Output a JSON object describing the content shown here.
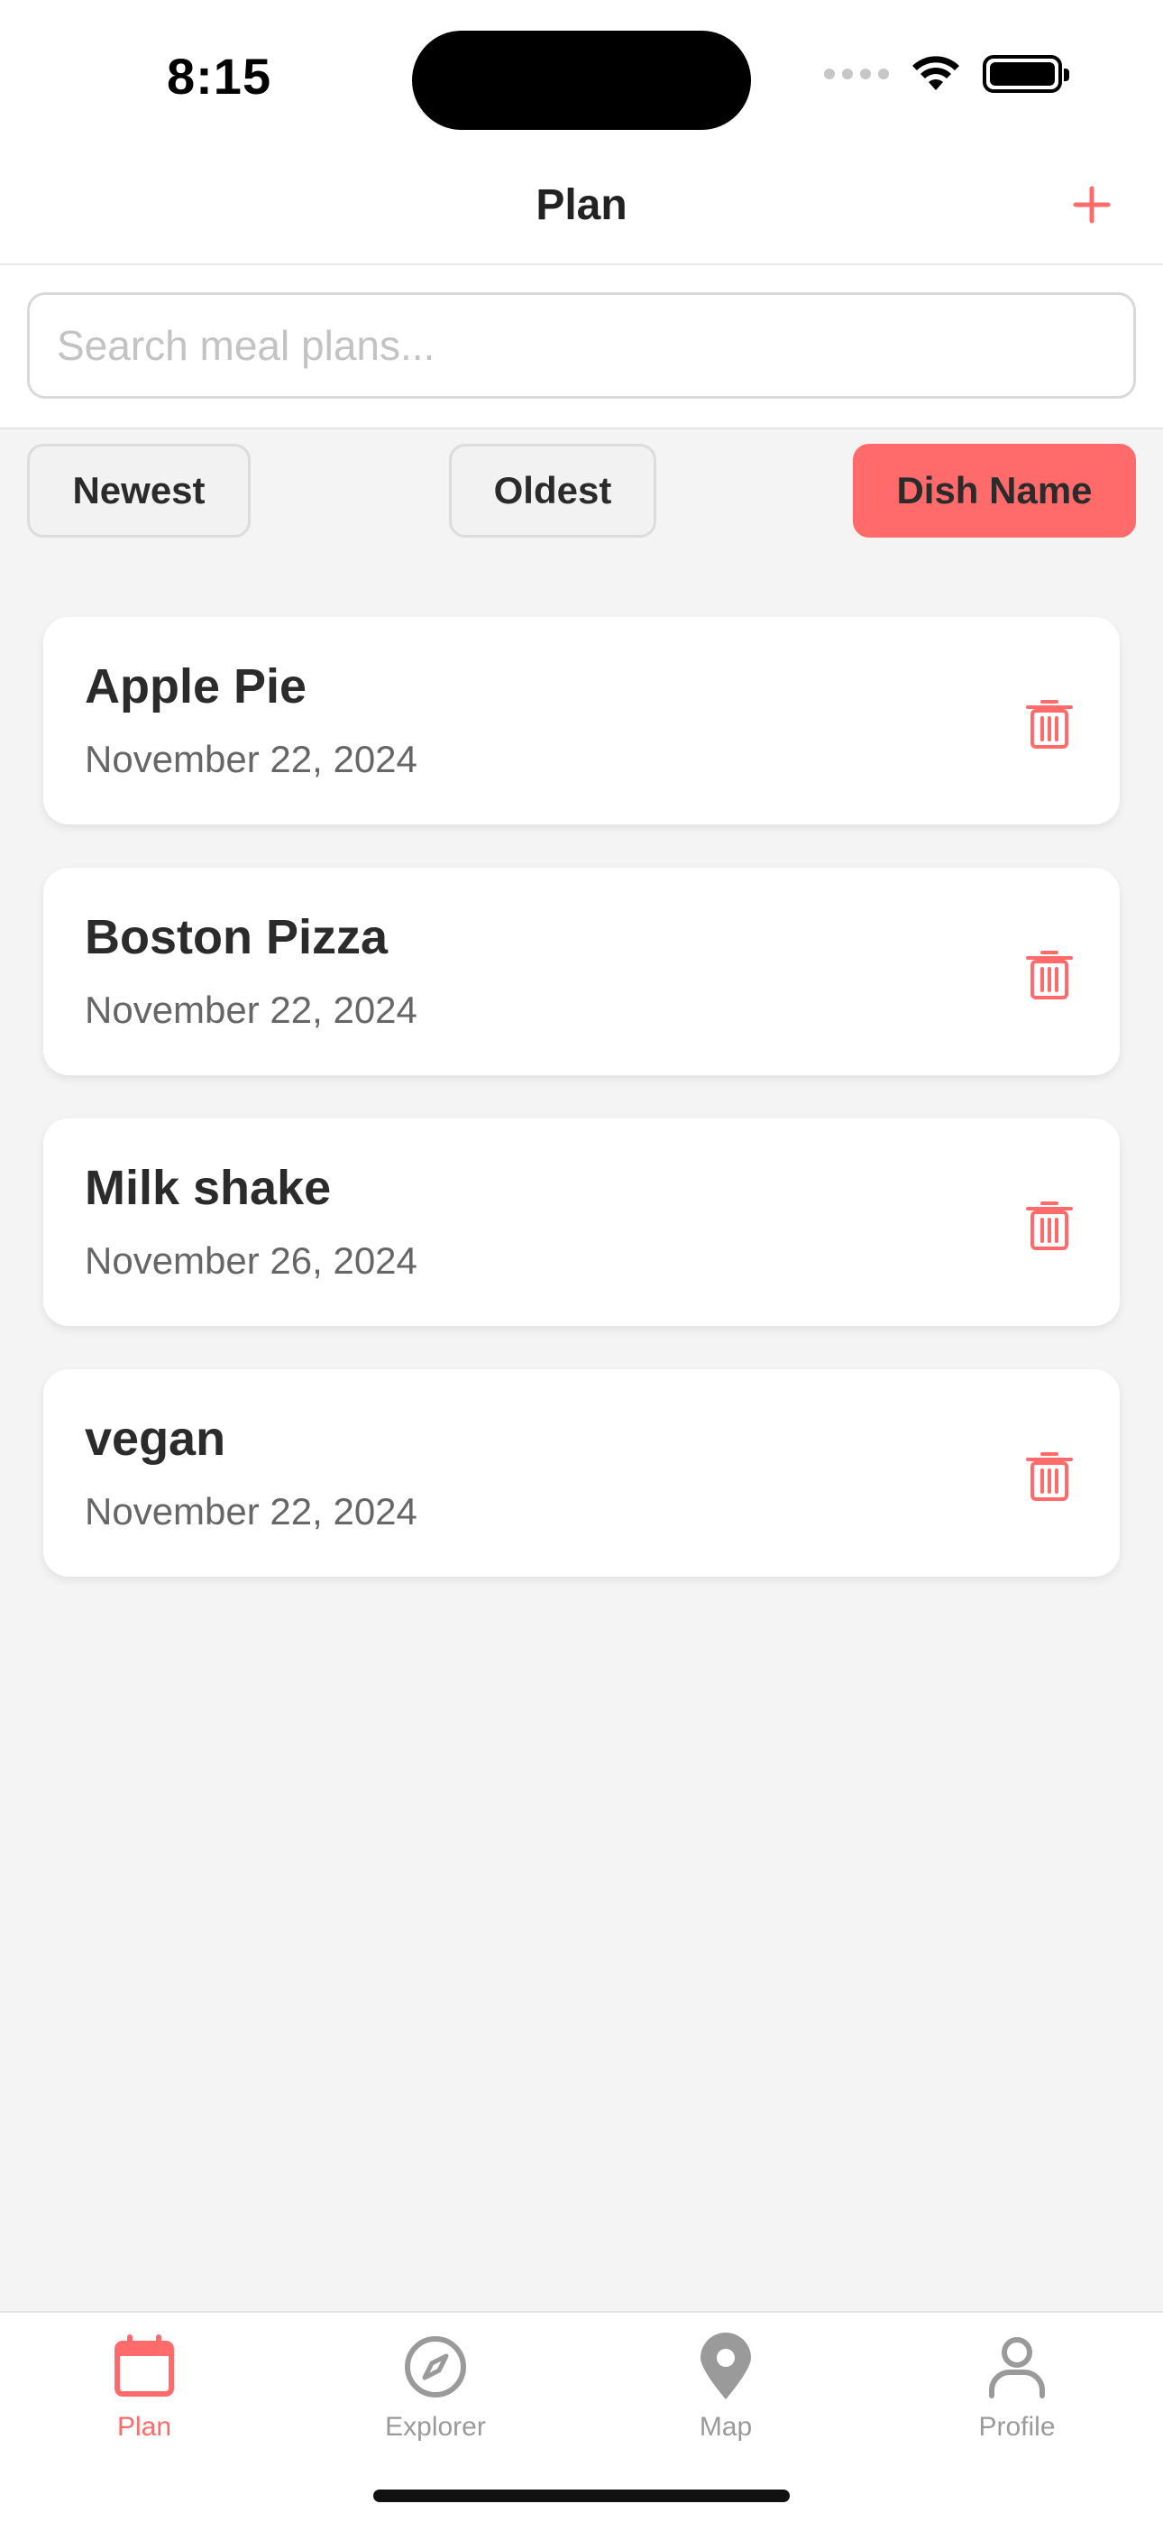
{
  "status_bar": {
    "time": "8:15"
  },
  "header": {
    "title": "Plan",
    "add_icon": "plus-icon"
  },
  "search": {
    "placeholder": "Search meal plans...",
    "value": ""
  },
  "sort": {
    "newest": "Newest",
    "oldest": "Oldest",
    "dish_name": "Dish Name",
    "active": "Dish Name"
  },
  "plans": [
    {
      "name": "Apple Pie",
      "date": "November 22, 2024"
    },
    {
      "name": "Boston Pizza",
      "date": "November 22, 2024"
    },
    {
      "name": "Milk shake",
      "date": "November 26, 2024"
    },
    {
      "name": "vegan",
      "date": "November 22, 2024"
    }
  ],
  "tabs": [
    {
      "label": "Plan",
      "icon": "calendar-icon",
      "active": true
    },
    {
      "label": "Explorer",
      "icon": "compass-icon",
      "active": false
    },
    {
      "label": "Map",
      "icon": "map-pin-icon",
      "active": false
    },
    {
      "label": "Profile",
      "icon": "person-icon",
      "active": false
    }
  ],
  "colors": {
    "accent": "#ff6b6b",
    "inactive": "#9a9a9a",
    "background": "#f4f4f4"
  }
}
